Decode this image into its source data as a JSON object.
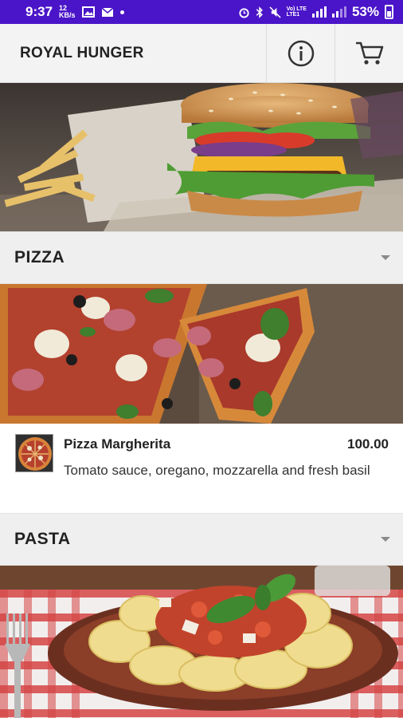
{
  "status_bar": {
    "time": "9:37",
    "data_speed": "12\nKB/s",
    "network": "Vo) LTE\nLTE1",
    "battery_percent": "53%"
  },
  "app_bar": {
    "title": "ROYAL HUNGER",
    "info_icon": "info-icon",
    "cart_icon": "cart-icon"
  },
  "categories": [
    {
      "title": "PIZZA",
      "items": [
        {
          "name": "Pizza Margherita",
          "price": "100.00",
          "description": "Tomato sauce, oregano, mozzarella and fresh basil"
        }
      ]
    },
    {
      "title": "PASTA",
      "items": []
    }
  ],
  "colors": {
    "status_bar": "#4a14c8",
    "app_bar": "#f3f3f3",
    "category_header": "#efefef"
  }
}
